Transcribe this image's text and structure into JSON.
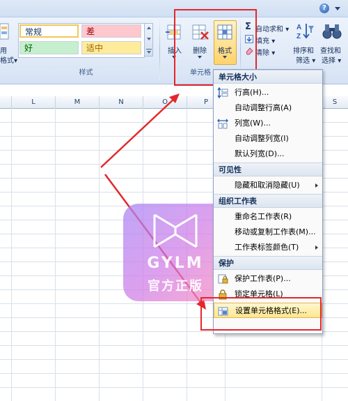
{
  "ribbon": {
    "left_partial": {
      "line1": "用",
      "line2": "格式",
      "chevron": "▾"
    },
    "styles": {
      "cells": [
        {
          "label": "常规",
          "bg": "#ffffff"
        },
        {
          "label": "差",
          "bg": "#ffc7ce",
          "color": "#9c0006"
        },
        {
          "label": "好",
          "bg": "#c6efce",
          "color": "#006100"
        },
        {
          "label": "适中",
          "bg": "#ffeb9c",
          "color": "#9c6500"
        }
      ],
      "group_label": "样式"
    },
    "cells_group": {
      "insert": "插入",
      "delete": "删除",
      "format": "格式",
      "group_label": "单元格"
    },
    "editing": {
      "autosum": "自动求和",
      "fill": "填充",
      "clear": "清除",
      "sort_filter_line1": "排序和",
      "sort_filter_line2": "筛选",
      "find_line1": "查找和",
      "find_line2": "选择",
      "sigma": "Σ"
    },
    "help_icon": "?"
  },
  "columns": [
    "L",
    "M",
    "N",
    "O",
    "P",
    "S"
  ],
  "menu": {
    "sections": [
      {
        "title": "单元格大小"
      },
      {
        "title": "可见性"
      },
      {
        "title": "组织工作表"
      },
      {
        "title": "保护"
      }
    ],
    "items": {
      "row_height": "行高(H)...",
      "autofit_row": "自动调整行高(A)",
      "col_width": "列宽(W)...",
      "autofit_col": "自动调整列宽(I)",
      "default_width": "默认列宽(D)...",
      "hide_unhide": "隐藏和取消隐藏(U)",
      "rename": "重命名工作表(R)",
      "move_copy": "移动或复制工作表(M)...",
      "tab_color": "工作表标签颜色(T)",
      "protect_sheet": "保护工作表(P)...",
      "lock_cell": "锁定单元格(L)",
      "format_cells": "设置单元格格式(E)..."
    }
  },
  "watermark": {
    "brand": "GYLM",
    "tagline": "官方正版"
  },
  "colors": {
    "annotation": "#e3272b",
    "ribbon_text": "#15305a"
  }
}
